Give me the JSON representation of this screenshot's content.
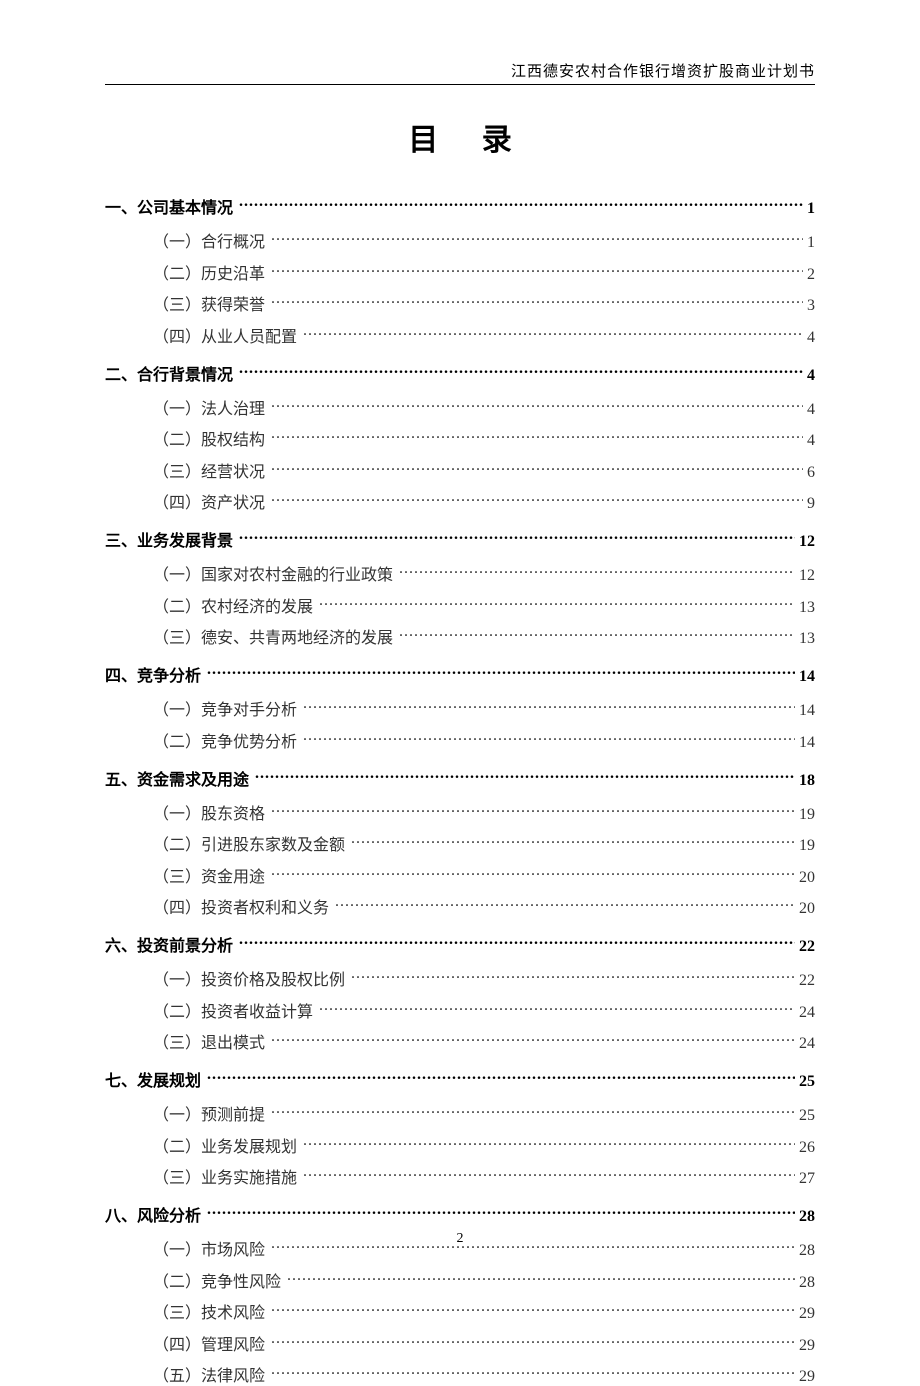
{
  "header": "江西德安农村合作银行增资扩股商业计划书",
  "title": "目 录",
  "page_number": "2",
  "toc": [
    {
      "label": "一、公司基本情况",
      "page": "1",
      "children": [
        {
          "label": "（一）合行概况",
          "page": "1"
        },
        {
          "label": "（二）历史沿革",
          "page": "2"
        },
        {
          "label": "（三）获得荣誉",
          "page": "3"
        },
        {
          "label": "（四）从业人员配置",
          "page": "4"
        }
      ]
    },
    {
      "label": "二、合行背景情况",
      "page": "4",
      "children": [
        {
          "label": "（一）法人治理",
          "page": "4"
        },
        {
          "label": "（二）股权结构",
          "page": "4"
        },
        {
          "label": "（三）经营状况",
          "page": "6"
        },
        {
          "label": "（四）资产状况",
          "page": "9"
        }
      ]
    },
    {
      "label": "三、业务发展背景",
      "page": "12",
      "children": [
        {
          "label": "（一）国家对农村金融的行业政策",
          "page": "12"
        },
        {
          "label": "（二）农村经济的发展",
          "page": "13"
        },
        {
          "label": "（三）德安、共青两地经济的发展",
          "page": "13"
        }
      ]
    },
    {
      "label": "四、竞争分析",
      "page": "14",
      "children": [
        {
          "label": "（一）竞争对手分析",
          "page": "14"
        },
        {
          "label": "（二）竞争优势分析",
          "page": "14"
        }
      ]
    },
    {
      "label": "五、资金需求及用途",
      "page": "18",
      "children": [
        {
          "label": "（一）股东资格",
          "page": "19"
        },
        {
          "label": "（二）引进股东家数及金额",
          "page": "19"
        },
        {
          "label": "（三）资金用途",
          "page": "20"
        },
        {
          "label": "（四）投资者权利和义务",
          "page": "20"
        }
      ]
    },
    {
      "label": "六、投资前景分析",
      "page": "22",
      "children": [
        {
          "label": "（一）投资价格及股权比例",
          "page": "22"
        },
        {
          "label": "（二）投资者收益计算",
          "page": "24"
        },
        {
          "label": "（三）退出模式",
          "page": "24"
        }
      ]
    },
    {
      "label": "七、发展规划",
      "page": "25",
      "children": [
        {
          "label": "（一）预测前提",
          "page": "25"
        },
        {
          "label": "（二）业务发展规划",
          "page": "26"
        },
        {
          "label": "（三）业务实施措施",
          "page": "27"
        }
      ]
    },
    {
      "label": "八、风险分析",
      "page": "28",
      "children": [
        {
          "label": "（一）市场风险",
          "page": "28"
        },
        {
          "label": "（二）竞争性风险",
          "page": "28"
        },
        {
          "label": "（三）技术风险",
          "page": "29"
        },
        {
          "label": "（四）管理风险",
          "page": "29"
        },
        {
          "label": "（五）法律风险",
          "page": "29"
        }
      ]
    }
  ]
}
